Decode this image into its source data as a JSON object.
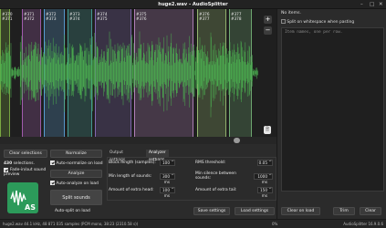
{
  "window": {
    "title": "huge2.wav - AudioSplitter",
    "minimize_glyph": "–",
    "maximize_glyph": "□",
    "close_glyph": "✕"
  },
  "waveform": {
    "segments": [
      {
        "label": "#370",
        "id": "#371",
        "color": "#8bc34a"
      },
      {
        "label": "#371",
        "id": "#372",
        "color": "#ba68c8"
      },
      {
        "label": "#372",
        "id": "#373",
        "color": "#64b5f6"
      },
      {
        "label": "#373",
        "id": "#374",
        "color": "#4db6ac"
      },
      {
        "label": "#374",
        "id": "#375",
        "color": "#9575cd"
      },
      {
        "label": "#375",
        "id": "#376",
        "color": "#ce93d8"
      },
      {
        "label": "#376",
        "id": "#377",
        "color": "#aed581"
      },
      {
        "label": "#377",
        "id": "#378",
        "color": "#81c784"
      }
    ],
    "zoom_in": "+",
    "zoom_out": "−",
    "wave_color": "#4caf50"
  },
  "right_panel": {
    "no_items": "No items.",
    "split_whitespace_label": "Split on whitespace when pasting",
    "split_whitespace_checked": false,
    "textarea_placeholder": "Item names, one per row.",
    "clear_on_load": "Clear on load",
    "trim": "Trim",
    "clear": "Clear"
  },
  "controls": {
    "clear_selections": "Clear selections",
    "normalize": "Normalize",
    "selection_count": "430",
    "selections_label": "selections.",
    "fade_label": "Fade-in/out sound preview",
    "fade_checked": true,
    "auto_normalize": "Auto-normalize on load",
    "auto_normalize_checked": true,
    "analyze": "Analyze",
    "auto_analyze": "Auto-analyze on load",
    "auto_analyze_checked": true,
    "split_sounds": "Split sounds",
    "auto_split": "Auto-split on load",
    "logo_text": "AS"
  },
  "tabs": [
    {
      "label": "Output settings",
      "active": false
    },
    {
      "label": "Analyzer settings",
      "active": true
    }
  ],
  "analyzer": {
    "block_length_label": "Block length (samples):",
    "block_length_value": "100",
    "min_sounds_label": "Min length of sounds:",
    "min_sounds_value": "300 ms",
    "extra_head_label": "Amount of extra head:",
    "extra_head_value": "100 ms",
    "rms_label": "RMS threshold:",
    "rms_value": "0.05",
    "min_silence_label": "Min silence between sounds:",
    "min_silence_value": "1000 ms",
    "extra_tail_label": "Amount of extra tail:",
    "extra_tail_value": "150 ms",
    "save_settings": "Save settings",
    "load_settings": "Load settings"
  },
  "status": {
    "left": "huge2.wav  44.1 kHz, 48 871 035 samples (PCM mono, 38:23 (2310.58 s))",
    "progress": "0%",
    "right": "AudioSplitter 16.9.0.6"
  }
}
